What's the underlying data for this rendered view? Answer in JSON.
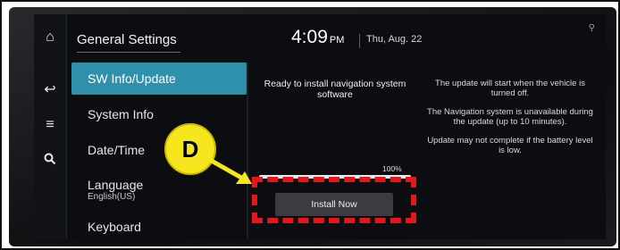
{
  "header": {
    "title": "General Settings",
    "time": "4:09",
    "ampm": "PM",
    "date": "Thu, Aug. 22"
  },
  "rail": {
    "icons": [
      "home-icon",
      "back-icon",
      "menu-icon",
      "search-icon"
    ]
  },
  "nav": {
    "items": [
      {
        "label": "SW Info/Update",
        "sub": ""
      },
      {
        "label": "System Info",
        "sub": ""
      },
      {
        "label": "Date/Time",
        "sub": ""
      },
      {
        "label": "Language",
        "sub": "English(US)"
      },
      {
        "label": "Keyboard",
        "sub": ""
      }
    ],
    "active_index": 0
  },
  "content": {
    "status": "Ready to install navigation system software",
    "progress_label": "100%",
    "progress_value": 100,
    "install_button": "Install Now"
  },
  "info": {
    "lines": [
      "The update will start when the vehicle is turned off.",
      "The Navigation system is unavailable during the update (up to 10 minutes).",
      "Update may not complete if the battery level is low."
    ]
  },
  "annotation": {
    "callout_label": "D",
    "colors": {
      "callout": "#f6e61d",
      "highlight": "#e4151b"
    }
  }
}
